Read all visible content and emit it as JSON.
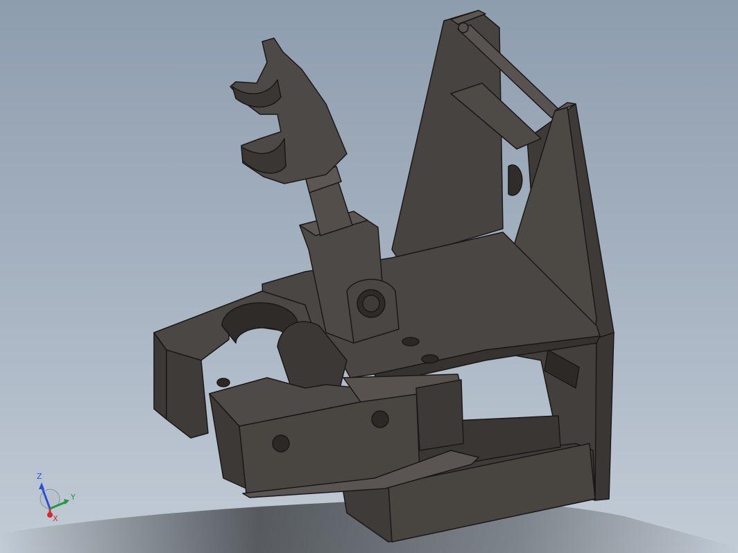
{
  "viewport": {
    "background_top": "#8e9dae",
    "background_bottom": "#c2ccd6",
    "part_color": "#4a4542",
    "edge_color": "#1a1817"
  },
  "triad": {
    "z_label": "Z",
    "y_label": "Y",
    "x_label": "X",
    "z_color": "#2a4fd6",
    "y_color": "#1f9a3c",
    "x_color": "#d42a2a"
  }
}
